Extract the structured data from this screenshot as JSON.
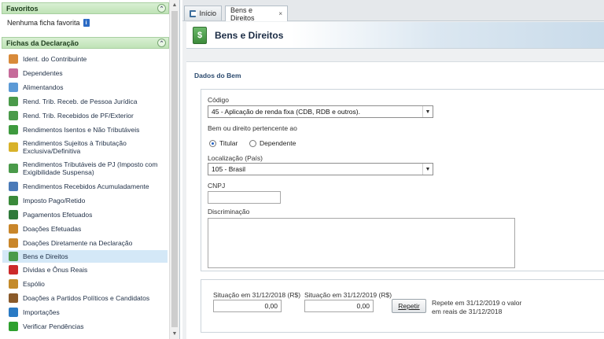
{
  "sidebar": {
    "favoritos": {
      "title": "Favoritos",
      "empty_text": "Nenhuma ficha favorita"
    },
    "fichas": {
      "title": "Fichas da Declaração",
      "items": [
        {
          "label": "Ident. do Contribuinte",
          "icon": "person-icon",
          "color": "#d88a3a"
        },
        {
          "label": "Dependentes",
          "icon": "family-icon",
          "color": "#c66b9a"
        },
        {
          "label": "Alimentandos",
          "icon": "child-icon",
          "color": "#5c9ad6"
        },
        {
          "label": "Rend. Trib. Receb. de Pessoa Jurídica",
          "icon": "money-arrow-icon",
          "color": "#4a9a4a"
        },
        {
          "label": "Rend. Trib. Recebidos de PF/Exterior",
          "icon": "money-arrow-icon",
          "color": "#4a9a4a"
        },
        {
          "label": "Rendimentos Isentos e Não Tributáveis",
          "icon": "check-document-icon",
          "color": "#3e9a3e"
        },
        {
          "label": "Rendimentos Sujeitos à Tributação Exclusiva/Definitiva",
          "icon": "warning-document-icon",
          "color": "#d8b22a"
        },
        {
          "label": "Rendimentos Tributáveis de PJ (Imposto com Exigibilidade Suspensa)",
          "icon": "money-warning-icon",
          "color": "#4a9a4a"
        },
        {
          "label": "Rendimentos Recebidos Acumuladamente",
          "icon": "accumulated-document-icon",
          "color": "#4a7ab8"
        },
        {
          "label": "Imposto Pago/Retido",
          "icon": "tax-paid-icon",
          "color": "#3a8a3a"
        },
        {
          "label": "Pagamentos Efetuados",
          "icon": "payment-card-icon",
          "color": "#2f7a3a"
        },
        {
          "label": "Doações Efetuadas",
          "icon": "donation-icon",
          "color": "#c9862a"
        },
        {
          "label": "Doações Diretamente na Declaração",
          "icon": "donation-direct-icon",
          "color": "#c9862a"
        },
        {
          "label": "Bens e Direitos",
          "icon": "assets-icon",
          "color": "#4a9a4a"
        },
        {
          "label": "Dívidas e Ônus Reais",
          "icon": "debt-arrow-icon",
          "color": "#cc2a2a"
        },
        {
          "label": "Espólio",
          "icon": "estate-icon",
          "color": "#c48a2a"
        },
        {
          "label": "Doações a Partidos Políticos e Candidatos",
          "icon": "political-donation-icon",
          "color": "#8a5a2a"
        },
        {
          "label": "Importações",
          "icon": "import-globe-icon",
          "color": "#2a7ac4"
        },
        {
          "label": "Verificar Pendências",
          "icon": "checkmark-icon",
          "color": "#2ea02e"
        }
      ]
    }
  },
  "tabs": [
    {
      "label": "Início",
      "icon": "home-icon"
    },
    {
      "label": "Bens e Direitos",
      "close": "×"
    }
  ],
  "page": {
    "title": "Bens e Direitos",
    "section_label": "Dados do Bem"
  },
  "form": {
    "codigo_label": "Código",
    "codigo_value": "45 - Aplicação de renda fixa (CDB, RDB e outros).",
    "pertencente_label": "Bem ou direito pertencente ao",
    "titular_label": "Titular",
    "dependente_label": "Dependente",
    "localizacao_label": "Localização (País)",
    "localizacao_value": "105 - Brasil",
    "cnpj_label": "CNPJ",
    "cnpj_value": "",
    "discriminacao_label": "Discriminação",
    "situacao_2018_label": "Situação em 31/12/2018 (R$)",
    "situacao_2018_value": "0,00",
    "situacao_2019_label": "Situação em 31/12/2019 (R$)",
    "situacao_2019_value": "0,00",
    "repetir_label": "Repetir",
    "repetir_note_line1": "Repete em 31/12/2019 o valor",
    "repetir_note_line2": "em reais de 31/12/2018"
  }
}
